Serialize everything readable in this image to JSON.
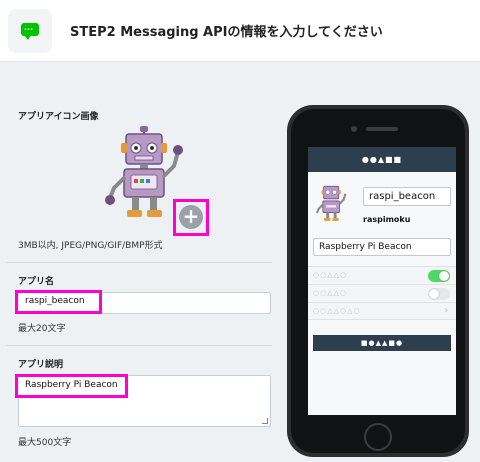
{
  "header": {
    "title": "STEP2   Messaging APIの情報を入力してください",
    "icon": "line-chat-icon",
    "accent": "#00c300"
  },
  "icon_section": {
    "label": "アプリアイコン画像",
    "hint": "3MB以内, JPEG/PNG/GIF/BMP形式",
    "upload_icon": "plus-icon"
  },
  "name_section": {
    "label": "アプリ名",
    "value": "raspi_beacon",
    "hint": "最大20文字"
  },
  "desc_section": {
    "label": "アプリ説明",
    "value": "Raspberry Pi Beacon",
    "hint": "最大500文字"
  },
  "highlight_color": "#ff00d2",
  "preview": {
    "header_text": "●●▲■■",
    "name": "raspi_beacon",
    "id": "raspimoku",
    "description": "Raspberry Pi Beacon",
    "rows": [
      {
        "text": "○○△△○",
        "control": "toggle",
        "on": true
      },
      {
        "text": "○○△△○",
        "control": "toggle",
        "on": false
      },
      {
        "text": "○○△△○△○",
        "control": "chevron"
      }
    ],
    "chevron": "›",
    "button_text": "■●▲▲■●",
    "header_color": "#2d3e4f"
  }
}
